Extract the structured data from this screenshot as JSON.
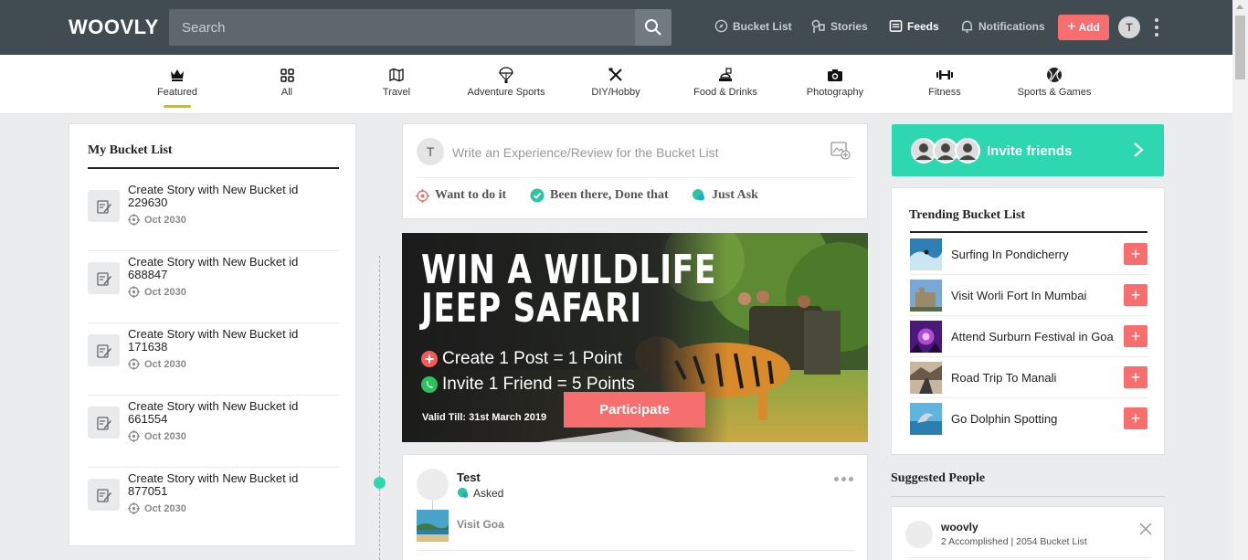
{
  "brand": {
    "logo": "WOOVLY"
  },
  "search": {
    "placeholder": "Search"
  },
  "nav": {
    "bucket_list": "Bucket List",
    "stories": "Stories",
    "feeds": "Feeds",
    "notifications": "Notifications",
    "add": "Add",
    "user_initial": "T"
  },
  "categories": [
    {
      "label": "Featured",
      "icon": "crown-icon"
    },
    {
      "label": "All",
      "icon": "grid-icon"
    },
    {
      "label": "Travel",
      "icon": "map-icon"
    },
    {
      "label": "Adventure Sports",
      "icon": "parachute-icon"
    },
    {
      "label": "DIY/Hobby",
      "icon": "tools-icon"
    },
    {
      "label": "Food & Drinks",
      "icon": "food-icon"
    },
    {
      "label": "Photography",
      "icon": "camera-icon"
    },
    {
      "label": "Fitness",
      "icon": "dumbbell-icon"
    },
    {
      "label": "Sports & Games",
      "icon": "ball-icon"
    }
  ],
  "my_bucket_list": {
    "title": "My Bucket List",
    "items": [
      {
        "title": "Create Story with New Bucket id 229630",
        "date": "Oct 2030"
      },
      {
        "title": "Create Story with New Bucket id 688847",
        "date": "Oct 2030"
      },
      {
        "title": "Create Story with New Bucket id 171638",
        "date": "Oct 2030"
      },
      {
        "title": "Create Story with New Bucket id 661554",
        "date": "Oct 2030"
      },
      {
        "title": "Create Story with New Bucket id 877051",
        "date": "Oct 2030"
      }
    ]
  },
  "composer": {
    "avatar_initial": "T",
    "placeholder": "Write an Experience/Review for the Bucket List",
    "options": [
      "Want to do it",
      "Been there, Done that",
      "Just Ask"
    ],
    "colors": {
      "want": "#f76e6e",
      "been": "#2ec4a0",
      "ask": "#2ec4a0"
    }
  },
  "banner": {
    "headline_1": "WIN A WILDLIFE",
    "headline_2": "JEEP SAFARI",
    "line_1": "Create 1 Post = 1 Point",
    "line_2": "Invite 1 Friend = 5 Points",
    "valid": "Valid Till: 31st March 2019",
    "cta": "Participate"
  },
  "post": {
    "user": "Test",
    "action": "Asked",
    "bucket": "Visit Goa"
  },
  "invite": {
    "label": "Invite friends",
    "color": "#2dd8b1"
  },
  "trending": {
    "title": "Trending Bucket List",
    "items": [
      {
        "label": "Surfing In Pondicherry"
      },
      {
        "label": "Visit Worli Fort In Mumbai"
      },
      {
        "label": "Attend Surburn Festival in Goa"
      },
      {
        "label": "Road Trip To Manali"
      },
      {
        "label": "Go Dolphin Spotting"
      }
    ]
  },
  "suggested": {
    "title": "Suggested People",
    "people": [
      {
        "name": "woovly",
        "stats": "2 Accomplished | 2054 Bucket List"
      }
    ]
  },
  "colors": {
    "topbar": "#414b52",
    "accent_red": "#f76e6e",
    "accent_teal": "#2dd8b1",
    "featured_underline": "#d9b90d"
  }
}
